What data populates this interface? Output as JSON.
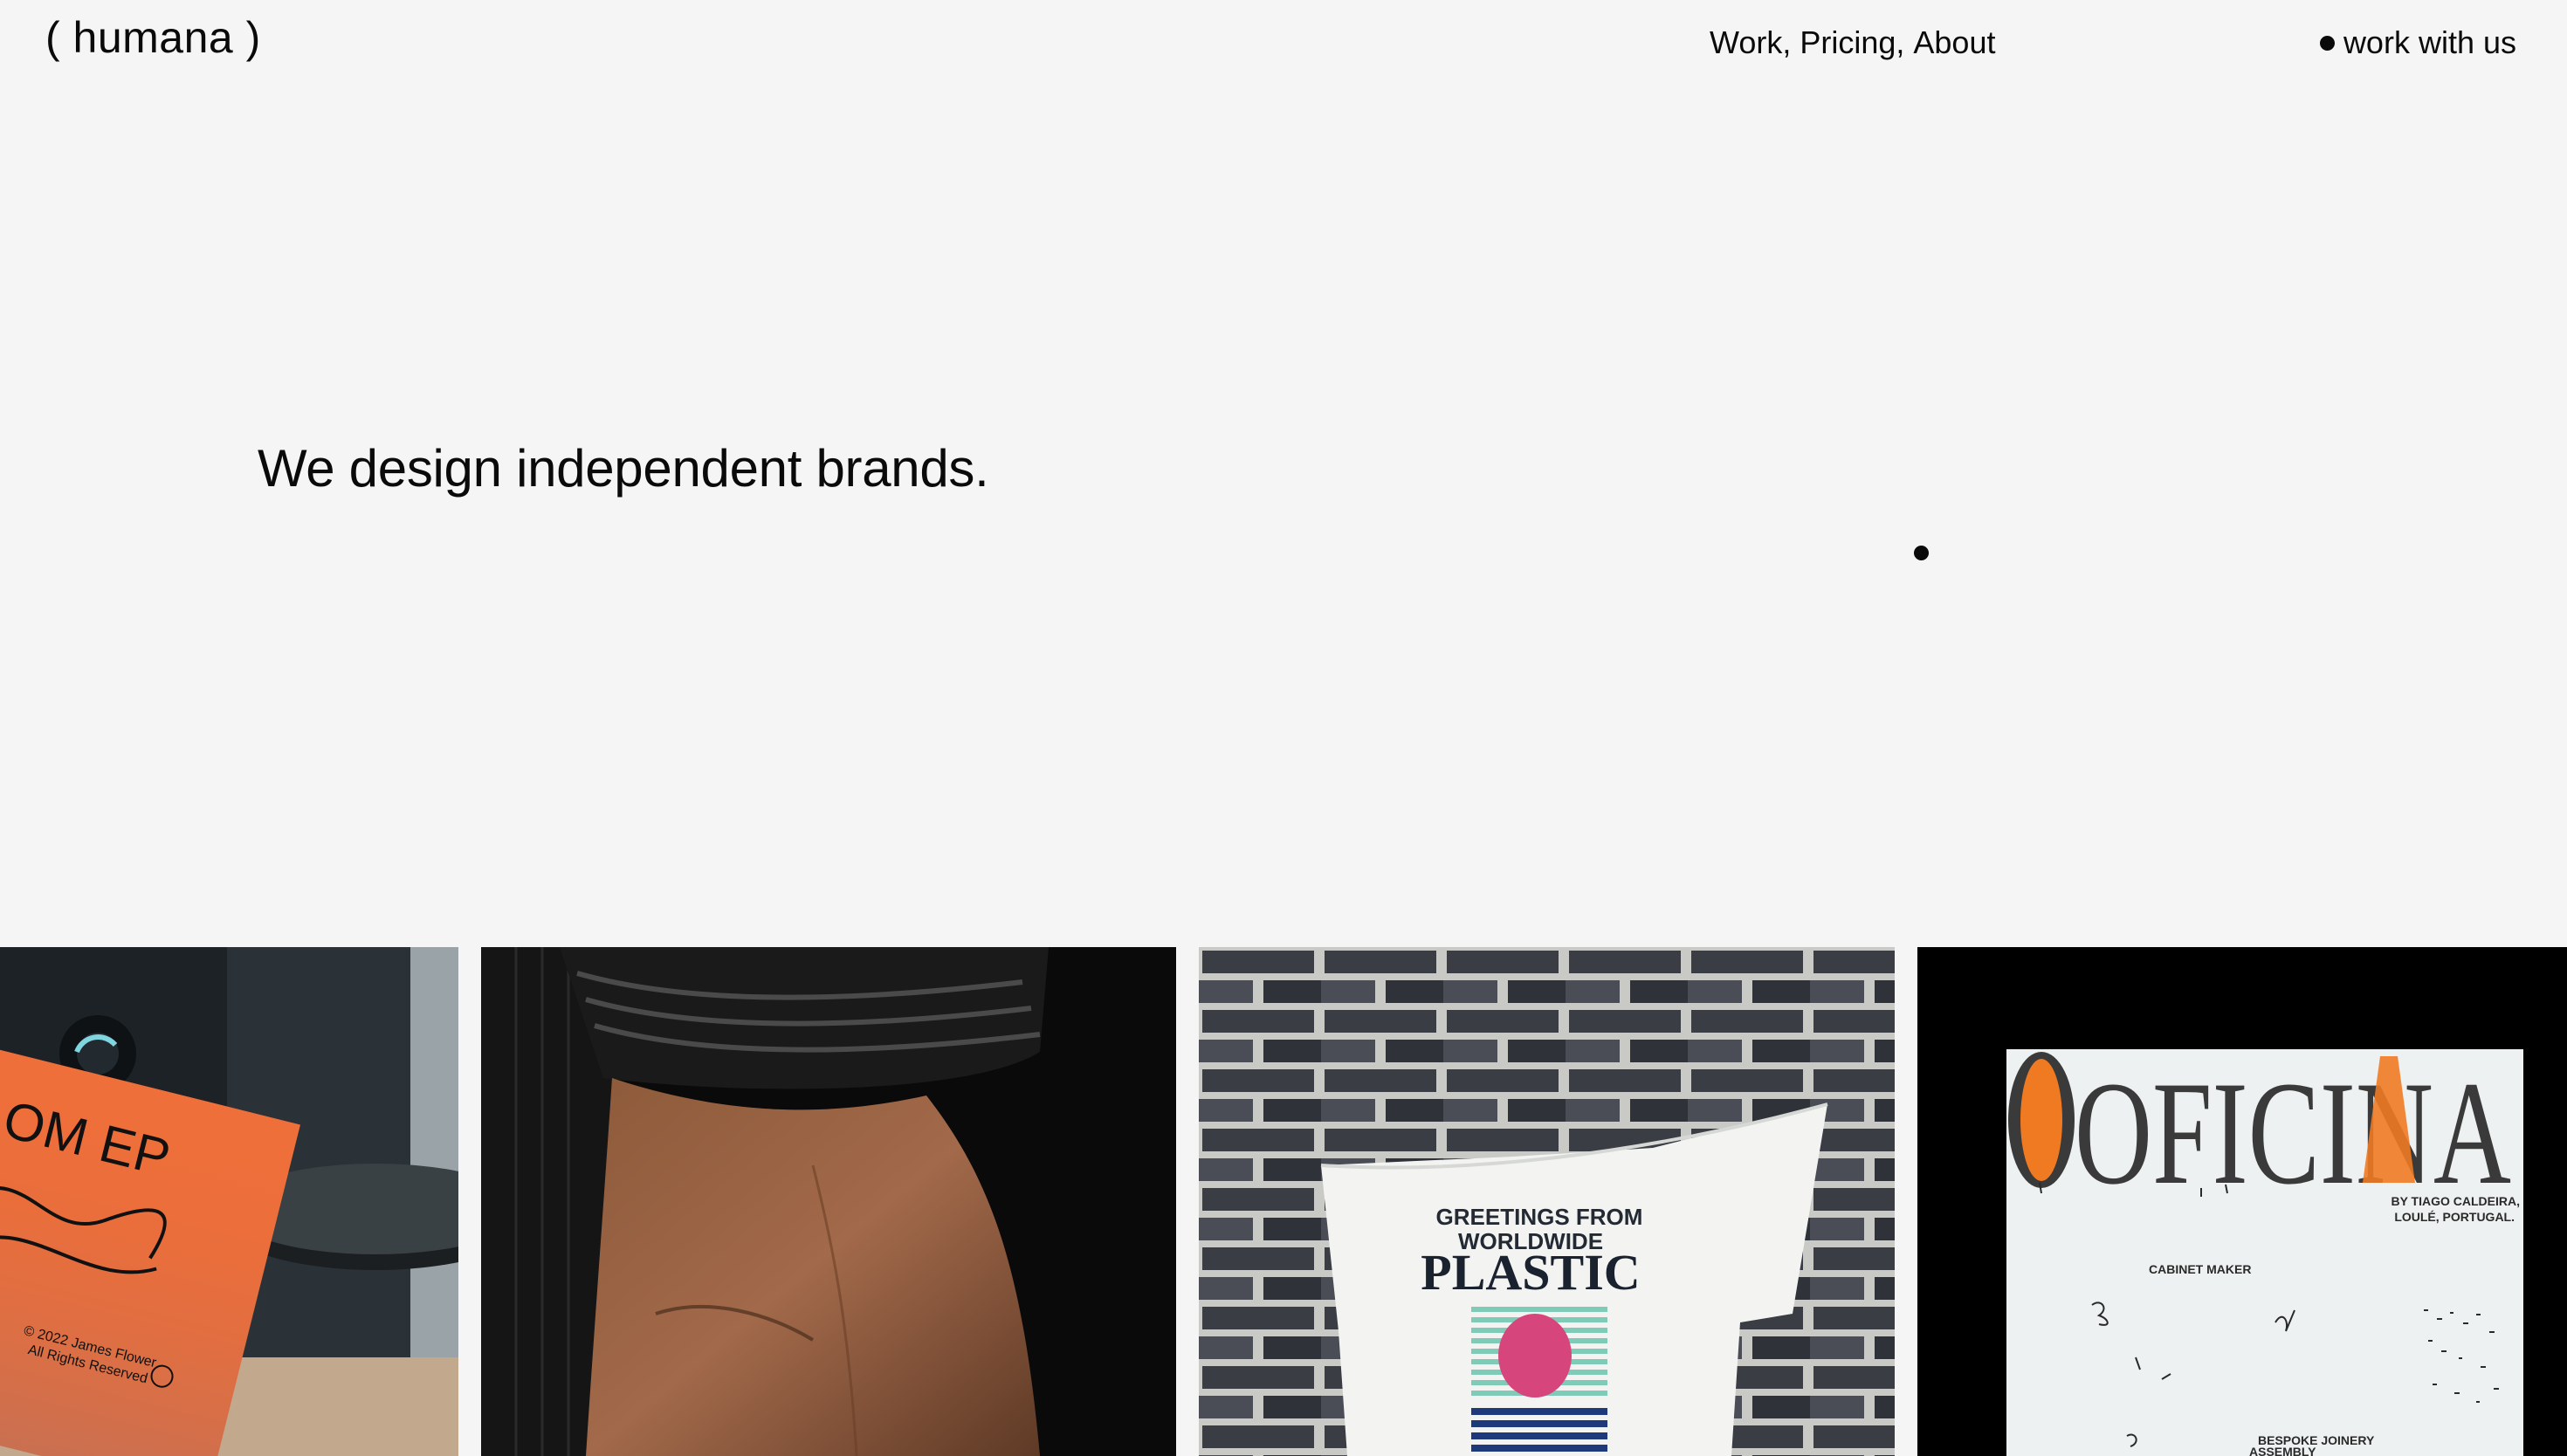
{
  "brand": {
    "logo": "( humana )"
  },
  "nav": {
    "items": [
      "Work,",
      "Pricing,",
      "About"
    ]
  },
  "cta": {
    "label": "work with us"
  },
  "hero": {
    "headline": "We design independent brands."
  },
  "projects": [
    {
      "name": "album-ep",
      "record_text": "OM EP",
      "credit_line1": "© 2022 James Flower",
      "credit_line2": "All Rights Reserved"
    },
    {
      "name": "hand-portrait"
    },
    {
      "name": "plastic-tshirt",
      "line1": "GREETINGS FROM",
      "line2": "WORLDWIDE",
      "line3": "PLASTIC"
    },
    {
      "name": "oficina",
      "title": "OFICINA",
      "byline1": "BY TIAGO CALDEIRA,",
      "byline2": "LOULÉ, PORTUGAL.",
      "label1": "CABINET MAKER",
      "label2": "BESPOKE JOINERY",
      "label3": "ASSEMBLY"
    }
  ],
  "colors": {
    "background": "#f5f5f5",
    "text": "#0a0a0a",
    "accent_orange": "#f07a22",
    "tshirt_pink": "#d6467c",
    "tshirt_teal": "#7fcbb8",
    "tshirt_navy": "#1f3a7a"
  }
}
